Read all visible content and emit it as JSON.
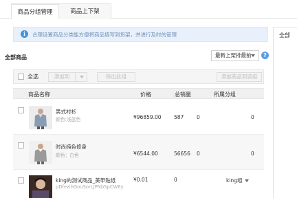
{
  "tabs": [
    {
      "label": "商品分组管理",
      "active": true
    },
    {
      "label": "商品上下架",
      "active": false
    }
  ],
  "notice": {
    "icon": "info-icon",
    "text": "合理设置商品分类能方便将商品填写到货架，并进行及时的管理"
  },
  "side_panel": {
    "label": "全部"
  },
  "section_title": "全部商品",
  "sort": {
    "selected": "最新上架排最前",
    "icon": "chevron-down-icon"
  },
  "help_icon": "question-icon",
  "toolbar": {
    "select_all_label": "全选",
    "add_to_label": "添加到",
    "remove_label": "移出此组",
    "add_group_label": "添加商品到该组"
  },
  "table": {
    "columns": [
      "商品名称",
      "价格",
      "总销量",
      "所属分组"
    ],
    "rows": [
      {
        "name": "男式衬衫",
        "sub": "颜色:浅蓝色",
        "price": "¥96859.00",
        "sales": "587",
        "extra": "0",
        "group": "0"
      },
      {
        "name": "时尚纯色修身",
        "sub": "颜色：白色",
        "price": "¥6544.00",
        "sales": "56656",
        "extra": "0",
        "group": "0"
      },
      {
        "name": "king的测试商品_美甲贴纸",
        "sub": "pDfezihGouSorLJPNbSpCW6y",
        "price": "¥0.01",
        "sales": "0",
        "extra": "",
        "group": "king组"
      }
    ]
  },
  "colors": {
    "accent": "#4a8fd8",
    "notice_bg": "#e8f1fb",
    "disabled_text": "#bdbdbd"
  }
}
